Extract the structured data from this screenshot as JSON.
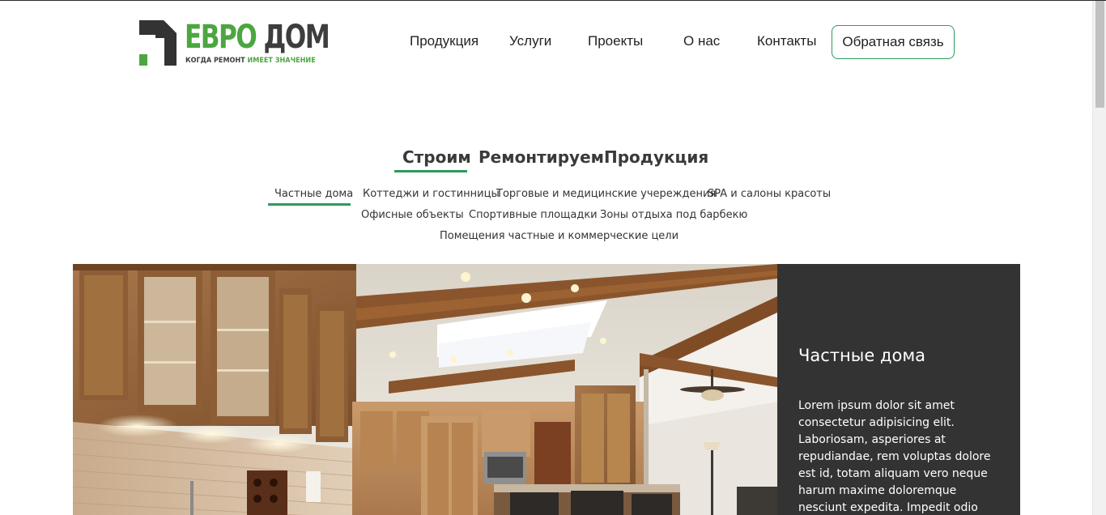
{
  "logo": {
    "title_part1": "ЕВРО",
    "title_part2": "ДОМ",
    "tagline_part1": "КОГДА РЕМОНТ ",
    "tagline_part2": "ИМЕЕТ ЗНАЧЕНИЕ"
  },
  "nav": {
    "items": [
      "Продукция",
      "Услуги",
      "Проекты",
      "О нас",
      "Контакты"
    ],
    "feedback_label": "Обратная связь"
  },
  "main_tabs": {
    "items": [
      "Строим",
      "Ремонтируем",
      "Продукция"
    ],
    "active": "Строим"
  },
  "sub_tabs": {
    "items": [
      "Частные дома",
      "Коттеджи и гостинницы",
      "Торговые и медицинские учереждения",
      "SPA и салоны красоты",
      "Офисные объекты",
      "Спортивные площадки",
      "Зоны отдыха под барбекю",
      "Помещения частные и коммерческие цели"
    ],
    "active": "Частные дома"
  },
  "hero": {
    "image": "kitchen-interior-photo"
  },
  "info": {
    "title": "Частные дома",
    "text": "Lorem ipsum dolor sit amet consectetur adipisicing elit. Laboriosam, asperiores at repudiandae, rem voluptas dolore est id, totam aliquam vero neque harum maxime doloremque nesciunt expedita. Impedit odio"
  },
  "colors": {
    "accent": "#2e9a5c",
    "logo_green": "#4ca640",
    "panel_bg": "#333333"
  }
}
